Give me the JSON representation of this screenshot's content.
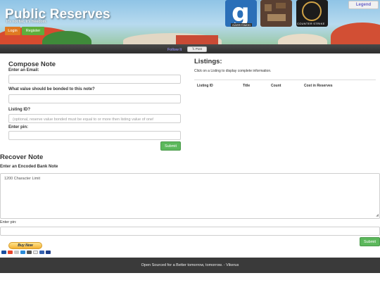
{
  "header": {
    "title": "Public Reserves",
    "tagline": "It's not fiat, it's freedom.",
    "login_label": "Login",
    "register_label": "Register",
    "legend_label": "Legend",
    "tiles": [
      {
        "name": "garrysmod",
        "letter": "g",
        "caption": "GARRYSMOD"
      },
      {
        "name": "minecraft"
      },
      {
        "name": "counter-strike",
        "caption": "COUNTER STRIKE"
      }
    ]
  },
  "social": {
    "follow_label": "Follow It",
    "post_label": "𝕏 Post"
  },
  "compose": {
    "title": "Compose Note",
    "email_label": "Enter an Email:",
    "email_value": "",
    "bond_label": "What value should be bonded to this note?",
    "bond_value": "",
    "listing_label": "Listing ID?",
    "listing_placeholder": "(optional, reserve value bonded must be equal to or more then listing value of one!",
    "pin_label": "Enter pin:",
    "pin_value": "",
    "submit_label": "Submit"
  },
  "listings": {
    "title": "Listings:",
    "hint": "Click on a Listing to display complete information.",
    "columns": [
      "Listing ID",
      "Title",
      "Count",
      "Cost in Reserves"
    ]
  },
  "recover": {
    "title": "Recover Note",
    "code_label": "Enter an Encoded Bank Note",
    "code_placeholder": "1200 Character Limit",
    "pin_label": "Enter pin:",
    "submit_label": "Submit"
  },
  "paypal": {
    "buy_label": "Buy Now",
    "cards": [
      "visa",
      "mastercard",
      "maestro",
      "amex",
      "applepay",
      "discover",
      "dinersclub"
    ]
  },
  "footer": {
    "text": "Open Sourced for a Better tomorrow, tomorrow. - Vikerus"
  },
  "colors": {
    "accent_green": "#5cb85c",
    "login_orange": "#e07a22",
    "footer_bg": "#3a3a3a"
  }
}
